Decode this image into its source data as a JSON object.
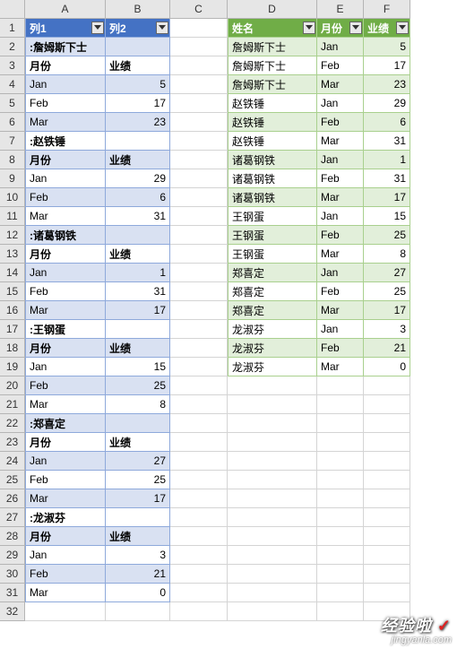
{
  "col_headers": [
    "A",
    "B",
    "C",
    "D",
    "E",
    "F"
  ],
  "row_count": 32,
  "t1": {
    "headers": [
      "列1",
      "列2"
    ],
    "rows": [
      [
        ":詹姆斯下士",
        ""
      ],
      [
        "月份",
        "业绩"
      ],
      [
        "Jan",
        "5"
      ],
      [
        "Feb",
        "17"
      ],
      [
        "Mar",
        "23"
      ],
      [
        ":赵铁锤",
        ""
      ],
      [
        "月份",
        "业绩"
      ],
      [
        "Jan",
        "29"
      ],
      [
        "Feb",
        "6"
      ],
      [
        "Mar",
        "31"
      ],
      [
        ":诸葛钢铁",
        ""
      ],
      [
        "月份",
        "业绩"
      ],
      [
        "Jan",
        "1"
      ],
      [
        "Feb",
        "31"
      ],
      [
        "Mar",
        "17"
      ],
      [
        ":王钢蛋",
        ""
      ],
      [
        "月份",
        "业绩"
      ],
      [
        "Jan",
        "15"
      ],
      [
        "Feb",
        "25"
      ],
      [
        "Mar",
        "8"
      ],
      [
        ":郑喜定",
        ""
      ],
      [
        "月份",
        "业绩"
      ],
      [
        "Jan",
        "27"
      ],
      [
        "Feb",
        "25"
      ],
      [
        "Mar",
        "17"
      ],
      [
        ":龙淑芬",
        ""
      ],
      [
        "月份",
        "业绩"
      ],
      [
        "Jan",
        "3"
      ],
      [
        "Feb",
        "21"
      ],
      [
        "Mar",
        "0"
      ]
    ]
  },
  "t2": {
    "headers": [
      "姓名",
      "月份",
      "业绩"
    ],
    "rows": [
      [
        "詹姆斯下士",
        "Jan",
        "5"
      ],
      [
        "詹姆斯下士",
        "Feb",
        "17"
      ],
      [
        "詹姆斯下士",
        "Mar",
        "23"
      ],
      [
        "赵铁锤",
        "Jan",
        "29"
      ],
      [
        "赵铁锤",
        "Feb",
        "6"
      ],
      [
        "赵铁锤",
        "Mar",
        "31"
      ],
      [
        "诸葛钢铁",
        "Jan",
        "1"
      ],
      [
        "诸葛钢铁",
        "Feb",
        "31"
      ],
      [
        "诸葛钢铁",
        "Mar",
        "17"
      ],
      [
        "王钢蛋",
        "Jan",
        "15"
      ],
      [
        "王钢蛋",
        "Feb",
        "25"
      ],
      [
        "王钢蛋",
        "Mar",
        "8"
      ],
      [
        "郑喜定",
        "Jan",
        "27"
      ],
      [
        "郑喜定",
        "Feb",
        "25"
      ],
      [
        "郑喜定",
        "Mar",
        "17"
      ],
      [
        "龙淑芬",
        "Jan",
        "3"
      ],
      [
        "龙淑芬",
        "Feb",
        "21"
      ],
      [
        "龙淑芬",
        "Mar",
        "0"
      ]
    ]
  },
  "watermark": {
    "top": "经验啦",
    "bottom": "jingyanla.com"
  }
}
